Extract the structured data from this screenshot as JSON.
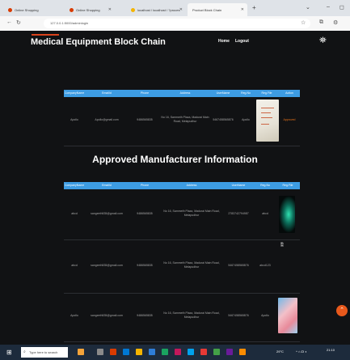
{
  "browser": {
    "tabs": [
      {
        "label": "Online Shopping",
        "color": "#d83b01"
      },
      {
        "label": "Online Shopping",
        "color": "#d83b01"
      },
      {
        "label": "localhost / localhost / ?proces",
        "color": "#f4b400"
      },
      {
        "label": "Product Block Chain",
        "color": "#0078d4"
      }
    ],
    "url": "127.0.0.1:5000/adminlogin",
    "icons": [
      "back-arrow-icon",
      "reload-icon",
      "favorite-star-icon",
      "settings-icon"
    ]
  },
  "navbar": {
    "brand": "Medical Equipment Block Chain",
    "menu": [
      "Home",
      "Logout"
    ],
    "brand_accent": "#d9421c"
  },
  "pending_table": {
    "columns": [
      "CompanyName",
      "EmailId",
      "Phone",
      "Address",
      "UserName",
      "Reg.No",
      "Reg.File",
      "Action"
    ],
    "rows": [
      {
        "company": "Apollo",
        "email": "Apollo@gmail.com",
        "phone": "9486565835",
        "address": "No 16, Sammeth Plaza, Madurai Main Road, Melapudhur",
        "username": "5467458565876",
        "regno": "Apollo",
        "action": "Approved"
      }
    ]
  },
  "approved_heading": "Approved Manufacturer Information",
  "approved_table": {
    "columns": [
      "CompanyName",
      "EmailId",
      "Phone",
      "Address",
      "UserName",
      "Reg.No",
      "Reg.File"
    ],
    "rows": [
      {
        "company": "abcd",
        "email": "sangeeth535@gmail.com",
        "phone": "9486565835",
        "address": "No 16, Sammeth Plaza, Madurai Main Road, Melapudhur",
        "username": "2783742794987",
        "regno": "abcd"
      },
      {
        "company": "abcd",
        "email": "sangeeth535@gmail.com",
        "phone": "9486565835",
        "address": "No 16, Sammeth Plaza, Madurai Main Road, Melapudhur",
        "username": "5467458565876",
        "regno": "abcd123"
      },
      {
        "company": "Apollo",
        "email": "sangeeth535@gmail.com",
        "phone": "9486565835",
        "address": "No 16, Sammeth Plaza, Madurai Main Road, Melapudhur",
        "username": "5467458565876",
        "regno": "Apollo"
      }
    ]
  },
  "colors": {
    "header_blue": "#3d9ce3",
    "page_bg": "#111214",
    "action_orange": "#e8731a",
    "fab_orange": "#e8591c"
  },
  "taskbar": {
    "search_placeholder": "Type here to search",
    "temperature": "29°C",
    "time": "21:10"
  }
}
